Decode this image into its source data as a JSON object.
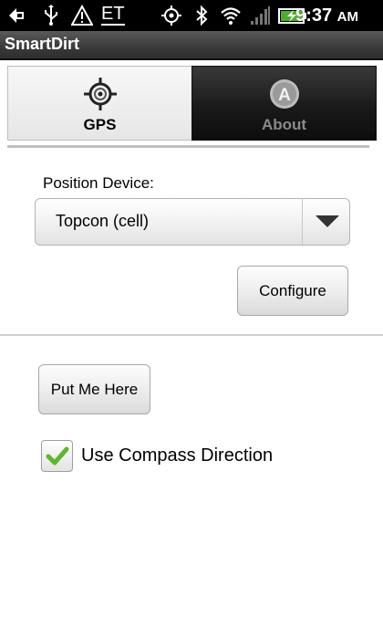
{
  "status_bar": {
    "network_label": "ET",
    "time": "9:37",
    "ampm": "AM",
    "icons": [
      "usb-debug-icon",
      "usb-icon",
      "warning-icon",
      "gps-icon",
      "bluetooth-icon",
      "wifi-icon",
      "signal-icon",
      "battery-charging-icon"
    ]
  },
  "app": {
    "title": "SmartDirt"
  },
  "tabs": [
    {
      "label": "GPS",
      "icon": "crosshair-icon",
      "selected": true
    },
    {
      "label": "About",
      "icon": "about-icon",
      "selected": false
    }
  ],
  "form": {
    "position_label": "Position Device:",
    "position_value": "Topcon (cell)",
    "configure_label": "Configure",
    "put_me_here_label": "Put Me Here",
    "compass_label": "Use Compass Direction",
    "compass_checked": true
  },
  "colors": {
    "check_green": "#5cb82e",
    "tab_dark": "#1a1a1a"
  }
}
